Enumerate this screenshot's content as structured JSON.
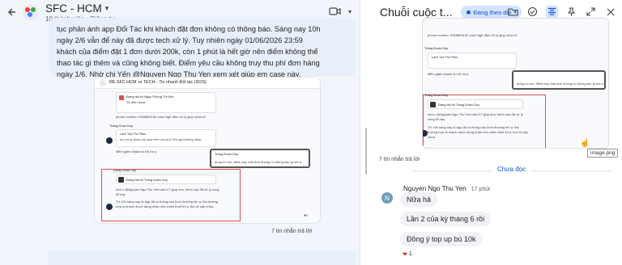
{
  "space": {
    "name": "SFC - HCM",
    "subtitle": "10 thành viên • Riêng tư"
  },
  "message": {
    "body": "tục phản ánh app Đối Tác khi khách đặt đơn không có thông báo. Sáng nay 10h ngày 2/6 vẫn để này đã được tech xử lý. Tuy nhiên ngày 01/06/2026 23:59 khách của điểm đặt 1 đơn dưới 200k, còn 1 phút là hết giờ nên điểm không thể thao tác gì thêm và cũng không biết. Điểm yêu cầu không truy thu phí đơn hàng ngày 1/6. Nhờ chị Yến",
    "mention": "@Nguyen Ngo Thu Yen",
    "tail": " xem xét giúp em case này."
  },
  "attachment_left": {
    "header": "RE:SFC HCM vs TECH - Tin nhanh Đối tác (SOS)",
    "lines": {
      "a1": "Đang trả lời Ngọc Phụng Thi Kim",
      "a2": "Số điện thoại",
      "a3": "phone number: 0368853152 case Ngữ điều xử lý giúp chúa ạ?",
      "a4": "Trang Doan Duy",
      "a5": "Lam Tuệ Thị Phúc",
      "a6": "em xử lý được cả case trên chưa ạ? Em gửi không nhận",
      "a7": "điểm giảm khách là 1/6 rồi ạ",
      "a8": "Trang Doan Duy",
      "a9": "dung rồi em, điểm này chia đơn không có thông báo gì hết ạ",
      "a10": "Trang Doan Duy",
      "a11": "Đang trả lời Trang Doan Duy",
      "a12": "nhờ c @Nguyen Ngo Thu Yen báo KT giúp nha, thêm này đã xử lý xong lỗi này",
      "a13": "Từ 10h sáng nay là app đã có thông báo bình thường lên ạ. Mà trường hợp là khách được đúng nhận nên chiều thuế thi ạ, thế về cấp chúa."
    }
  },
  "left_replies": "7 tin nhắn trả lời",
  "thread": {
    "title": "Chuỗi cuộc t...",
    "follow_label": "Đang theo dõi",
    "right_replies": "7 tin nhắn trả lời",
    "tooltip": "image.png",
    "unread_label": "Chưa đọc",
    "sender": "Nguyen Ngo Thu Yen",
    "sender_initial": "N",
    "time": "17 phút",
    "bubbles": [
      "Nữa hả",
      "Lần 2 của kỳ tháng 6 rồi",
      "Đồng ý top up bù 10k"
    ],
    "reaction_count": "1"
  },
  "attachment_right": {
    "lines": {
      "b1": "phone number: 0368853152 case Ngữ điều xử lý giúp chúa ạ?",
      "b2": "Trang Doan Duy",
      "b3": "Lam Tuệ Thị Phúc",
      "b4": "điểm giảm khách là 1/6 rồi ạ",
      "b5": "dung rồi em, điểm này chia đơn không có thông báo gì hết ạ",
      "b6": "Trang Doan Duy",
      "b7": "Đang trả lời Trang Doan Duy",
      "b8": "nhờ c @Nguyen Ngo Thu Yen báo KT giúp nha, thêm này đã xử lý xong lỗi này",
      "b9": "Từ 10h sáng nay là app đã có thông báo bình thường lên ạ. Mà trường hợp là khách được đúng nhận nên chiều thuế thi ạ, thế về cấp chúa."
    }
  },
  "colors": {
    "accent": "#0b57d0",
    "follow_bg": "#d3e3fd",
    "highlight_border": "#e24c4c",
    "avatar_n": "#6fa0ba"
  },
  "icons": [
    "back-arrow-icon",
    "chevron-down-icon",
    "video-call-icon",
    "folder-icon",
    "check-circle-icon",
    "thread-icon",
    "pin-icon",
    "expand-icon",
    "close-icon"
  ]
}
